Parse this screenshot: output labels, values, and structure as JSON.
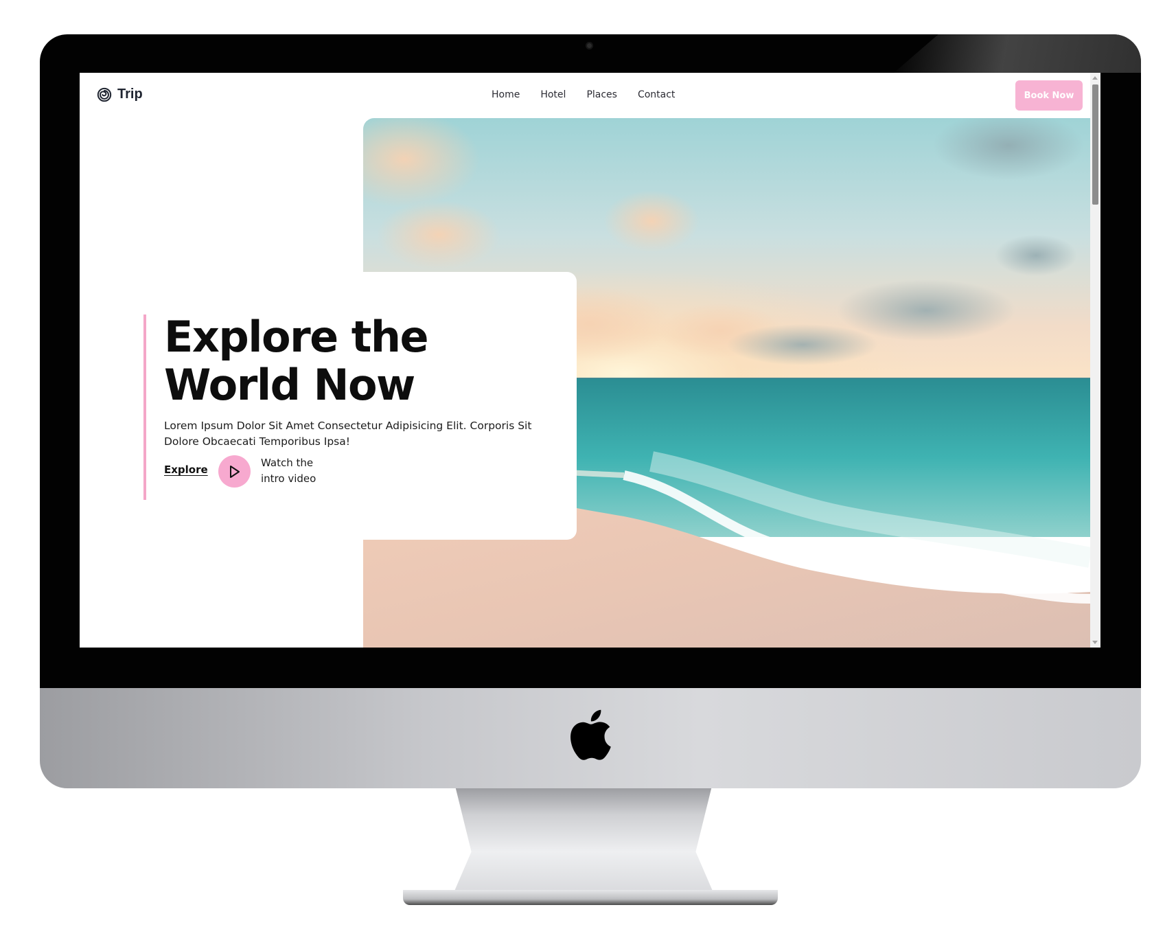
{
  "site": {
    "brand": "Trip",
    "nav": [
      {
        "label": "Home"
      },
      {
        "label": "Hotel"
      },
      {
        "label": "Places"
      },
      {
        "label": "Contact"
      }
    ],
    "cta_label": "Book Now"
  },
  "hero": {
    "title_line1": "Explore the",
    "title_line2": "World Now",
    "description": "Lorem Ipsum Dolor Sit Amet Consectetur Adipisicing Elit. Corporis Sit Dolore Obcaecati Temporibus Ipsa!",
    "explore_label": "Explore",
    "watch_line1": "Watch the",
    "watch_line2": "intro video"
  },
  "colors": {
    "accent_pink": "#f7b3d3",
    "text_dark": "#0d0d0d",
    "bezel": "#020202"
  },
  "icons": {
    "logo": "spiral-icon",
    "play": "play-icon",
    "device": "apple-icon"
  }
}
